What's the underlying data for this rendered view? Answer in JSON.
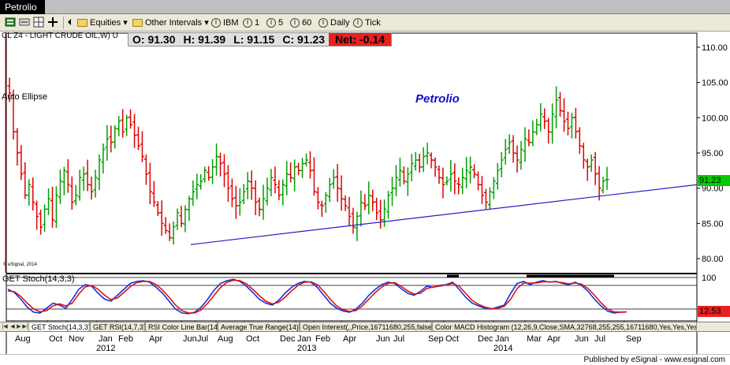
{
  "window": {
    "title": "Petrolio"
  },
  "toolbar": {
    "equities_label": "Equities",
    "intervals_label": "Other Intervals",
    "symbol_label": "IBM",
    "intervals": [
      "1",
      "5",
      "60",
      "Daily",
      "Tick"
    ]
  },
  "chart": {
    "symbol_line": "CL Z4 - LIGHT CRUDE OIL,W) U",
    "ohlc": {
      "open": "O: 91.30",
      "high": "H: 91.39",
      "low": "L: 91.15",
      "close": "C: 91.23",
      "net": "Net: -0.14"
    },
    "title": "Petrolio",
    "annotation": "Auto Ellipse",
    "watermark": "© eSignal, 2014",
    "last_price": "91.23",
    "colors": {
      "up": "#00a000",
      "down": "#e00000",
      "trendline": "#2020d0",
      "title": "#1010c8",
      "last_price_bg": "#00cc00",
      "net_bg": "#e82020"
    }
  },
  "chart_data": [
    {
      "type": "ohlc",
      "title": "Petrolio",
      "price_axis_ticks": [
        80,
        85,
        90,
        95,
        100,
        105,
        110
      ],
      "ylim": [
        78,
        112
      ],
      "time_labels": [
        "Aug",
        "Oct",
        "Nov",
        "Jan",
        "Feb",
        "Apr",
        "Jun",
        "Jul",
        "Aug",
        "Oct",
        "Dec",
        "Jan",
        "Feb",
        "Apr",
        "Jun",
        "Jul",
        "Sep",
        "Oct",
        "Dec",
        "Jan",
        "Mar",
        "Apr",
        "Jun",
        "Jul",
        "Sep"
      ],
      "year_labels": [
        "2012",
        "2013",
        "2014"
      ],
      "last_close": 91.23,
      "weekly_closes": [
        103.5,
        98.0,
        95.0,
        92.0,
        89.0,
        90.5,
        88.0,
        86.0,
        84.5,
        87.0,
        88.5,
        85.5,
        89.0,
        91.0,
        92.5,
        90.5,
        88.0,
        89.0,
        91.5,
        92.0,
        90.5,
        89.5,
        91.5,
        94.0,
        95.5,
        97.0,
        96.5,
        98.5,
        99.5,
        98.0,
        100.0,
        99.0,
        97.5,
        96.0,
        94.5,
        92.0,
        89.5,
        88.0,
        86.5,
        85.0,
        84.0,
        83.0,
        84.5,
        86.5,
        85.0,
        87.0,
        88.5,
        89.5,
        90.5,
        91.0,
        92.5,
        91.5,
        93.0,
        94.5,
        93.5,
        92.0,
        90.0,
        88.5,
        87.5,
        88.0,
        89.5,
        91.0,
        90.0,
        88.0,
        87.0,
        88.5,
        90.0,
        91.5,
        90.5,
        89.0,
        90.5,
        92.0,
        91.5,
        93.0,
        92.5,
        93.5,
        94.0,
        92.5,
        89.5,
        88.0,
        87.5,
        89.0,
        90.5,
        91.5,
        90.0,
        88.5,
        87.5,
        86.0,
        84.5,
        86.0,
        88.0,
        87.5,
        89.0,
        88.0,
        86.5,
        85.5,
        87.0,
        89.0,
        90.0,
        91.5,
        92.5,
        91.0,
        92.0,
        93.5,
        94.0,
        93.0,
        94.5,
        95.0,
        94.0,
        93.0,
        91.5,
        90.5,
        91.0,
        92.0,
        91.0,
        90.5,
        91.5,
        92.5,
        93.0,
        92.0,
        90.5,
        89.0,
        88.0,
        89.5,
        91.0,
        92.5,
        94.0,
        95.5,
        96.5,
        95.0,
        94.0,
        95.5,
        97.0,
        96.5,
        98.0,
        99.0,
        100.5,
        99.5,
        98.0,
        100.5,
        102.5,
        101.0,
        99.5,
        98.5,
        100.0,
        98.0,
        96.0,
        94.0,
        93.0,
        94.0,
        92.0,
        90.0,
        91.0,
        91.23
      ],
      "trendline": {
        "from": {
          "label": "Jun 2012",
          "value": 82.0
        },
        "to": {
          "label": "Sep 2014",
          "value": 90.5
        }
      }
    },
    {
      "type": "line",
      "title": "GET Stoch(14,3,3)",
      "axis_ticks": [
        100
      ],
      "ylim": [
        0,
        100
      ],
      "last_value": 12.53,
      "series": [
        {
          "name": "%K",
          "color": "#1030e0",
          "values": [
            70,
            62,
            45,
            25,
            12,
            10,
            22,
            35,
            30,
            22,
            45,
            70,
            82,
            78,
            60,
            45,
            40,
            55,
            70,
            85,
            90,
            92,
            88,
            75,
            60,
            40,
            20,
            10,
            8,
            12,
            25,
            45,
            68,
            85,
            92,
            95,
            90,
            78,
            62,
            45,
            35,
            30,
            42,
            60,
            75,
            85,
            90,
            88,
            75,
            55,
            35,
            22,
            15,
            12,
            20,
            35,
            55,
            70,
            82,
            88,
            85,
            72,
            60,
            55,
            65,
            78,
            75,
            80,
            82,
            88,
            70,
            50,
            35,
            28,
            22,
            20,
            25,
            30,
            60,
            85,
            90,
            82,
            88,
            92,
            88,
            90,
            85,
            82,
            88,
            80,
            65,
            45,
            28,
            15,
            10,
            12,
            12.53
          ]
        },
        {
          "name": "%D",
          "color": "#e01010",
          "values": [
            66,
            64,
            52,
            35,
            20,
            13,
            16,
            28,
            33,
            28,
            35,
            58,
            76,
            80,
            70,
            55,
            44,
            48,
            62,
            77,
            87,
            90,
            90,
            82,
            68,
            50,
            30,
            16,
            10,
            10,
            18,
            35,
            55,
            75,
            88,
            93,
            92,
            84,
            70,
            54,
            40,
            33,
            37,
            50,
            66,
            80,
            88,
            89,
            82,
            65,
            45,
            28,
            18,
            14,
            16,
            28,
            45,
            62,
            76,
            85,
            87,
            78,
            66,
            58,
            60,
            72,
            76,
            78,
            81,
            85,
            78,
            60,
            42,
            32,
            25,
            21,
            22,
            27,
            45,
            72,
            86,
            86,
            86,
            89,
            89,
            89,
            87,
            84,
            86,
            83,
            72,
            55,
            36,
            20,
            13,
            12,
            12.6
          ]
        }
      ]
    }
  ],
  "study_tabs": [
    "GET Stoch(14,3,3)",
    "GET RSI(14,7,3)",
    "RSI Color Line Bar(14)",
    "Average True Range(14)",
    "Open Interest(,,Price,16711680,255,false)",
    "Color MACD Histogram (12,26,9,Close,SMA,32768,255,255,16711680,Yes,Yes,Yes,Y"
  ],
  "footer": {
    "published": "Published by eSignal - www.esignal.com"
  }
}
